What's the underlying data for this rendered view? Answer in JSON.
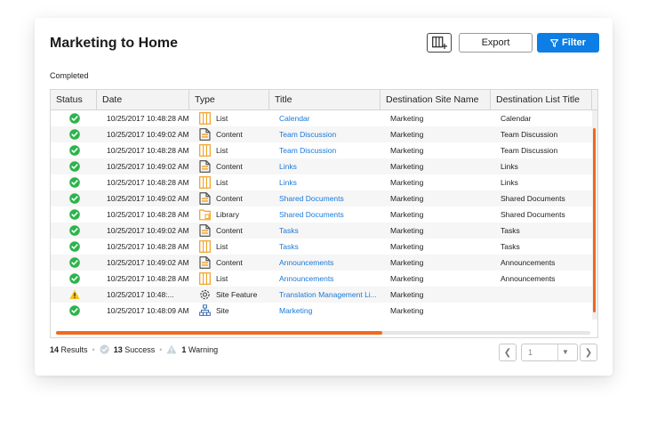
{
  "header": {
    "title": "Marketing to Home",
    "export_label": "Export",
    "filter_label": "Filter",
    "columns_icon": "column-chooser-icon",
    "filter_icon": "filter-funnel-icon"
  },
  "subtitle": "Completed",
  "grid": {
    "columns": [
      "Status",
      "Date",
      "Type",
      "Title",
      "Destination Site Name",
      "Destination List Title"
    ],
    "rows": [
      {
        "status": "success",
        "date": "10/25/2017 10:48:28 AM",
        "type": "List",
        "type_icon": "list-icon",
        "title": "Calendar",
        "site": "Marketing",
        "list": "Calendar"
      },
      {
        "status": "success",
        "date": "10/25/2017 10:49:02 AM",
        "type": "Content",
        "type_icon": "content-icon",
        "title": "Team Discussion",
        "site": "Marketing",
        "list": "Team Discussion"
      },
      {
        "status": "success",
        "date": "10/25/2017 10:48:28 AM",
        "type": "List",
        "type_icon": "list-icon",
        "title": "Team Discussion",
        "site": "Marketing",
        "list": "Team Discussion"
      },
      {
        "status": "success",
        "date": "10/25/2017 10:49:02 AM",
        "type": "Content",
        "type_icon": "content-icon",
        "title": "Links",
        "site": "Marketing",
        "list": "Links"
      },
      {
        "status": "success",
        "date": "10/25/2017 10:48:28 AM",
        "type": "List",
        "type_icon": "list-icon",
        "title": "Links",
        "site": "Marketing",
        "list": "Links"
      },
      {
        "status": "success",
        "date": "10/25/2017 10:49:02 AM",
        "type": "Content",
        "type_icon": "content-icon",
        "title": "Shared Documents",
        "site": "Marketing",
        "list": "Shared Documents"
      },
      {
        "status": "success",
        "date": "10/25/2017 10:48:28 AM",
        "type": "Library",
        "type_icon": "library-icon",
        "title": "Shared Documents",
        "site": "Marketing",
        "list": "Shared Documents"
      },
      {
        "status": "success",
        "date": "10/25/2017 10:49:02 AM",
        "type": "Content",
        "type_icon": "content-icon",
        "title": "Tasks",
        "site": "Marketing",
        "list": "Tasks"
      },
      {
        "status": "success",
        "date": "10/25/2017 10:48:28 AM",
        "type": "List",
        "type_icon": "list-icon",
        "title": "Tasks",
        "site": "Marketing",
        "list": "Tasks"
      },
      {
        "status": "success",
        "date": "10/25/2017 10:49:02 AM",
        "type": "Content",
        "type_icon": "content-icon",
        "title": "Announcements",
        "site": "Marketing",
        "list": "Announcements"
      },
      {
        "status": "success",
        "date": "10/25/2017 10:48:28 AM",
        "type": "List",
        "type_icon": "list-icon",
        "title": "Announcements",
        "site": "Marketing",
        "list": "Announcements"
      },
      {
        "status": "warning",
        "date": "10/25/2017 10:48:...",
        "type": "Site Feature",
        "type_icon": "gear-icon",
        "title": "Translation Management Li...",
        "site": "Marketing",
        "list": ""
      },
      {
        "status": "success",
        "date": "10/25/2017 10:48:09 AM",
        "type": "Site",
        "type_icon": "sitemap-icon",
        "title": "Marketing",
        "site": "Marketing",
        "list": ""
      }
    ]
  },
  "footer": {
    "results_count": "14",
    "results_label": "Results",
    "success_count": "13",
    "success_label": "Success",
    "warning_count": "1",
    "warning_label": "Warning"
  },
  "pager": {
    "page": "1"
  },
  "colors": {
    "accent": "#0c7ee5",
    "link": "#1a78d6",
    "success": "#2fb24c",
    "warning": "#f5c318",
    "scroll_thumb": "#ee6a1f",
    "type_icon": "#f0a020"
  }
}
